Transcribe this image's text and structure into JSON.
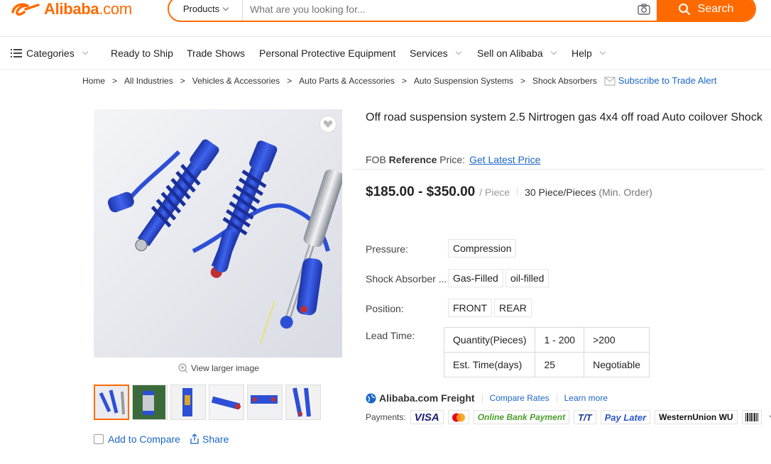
{
  "header": {
    "logo_brand": "Alibaba",
    "logo_suffix": ".com",
    "search_category": "Products",
    "search_placeholder": "What are you looking for...",
    "search_button": "Search"
  },
  "nav": {
    "categories": "Categories",
    "items": [
      "Ready to Ship",
      "Trade Shows",
      "Personal Protective Equipment",
      "Services",
      "Sell on Alibaba",
      "Help"
    ]
  },
  "breadcrumb": {
    "items": [
      "Home",
      "All Industries",
      "Vehicles & Accessories",
      "Auto Parts & Accessories",
      "Auto Suspension Systems",
      "Shock Absorbers"
    ],
    "separator": ">",
    "subscribe": "Subscribe to Trade Alert"
  },
  "gallery": {
    "view_larger": "View larger image",
    "add_to_compare": "Add to Compare",
    "share": "Share"
  },
  "product": {
    "title": "Off road suspension system 2.5 Nirtrogen gas 4x4 off road Auto coilover Shock",
    "fob_prefix": "FOB",
    "fob_bold": "Reference",
    "fob_suffix": "Price:",
    "fob_link": "Get Latest Price",
    "price": "$185.00 - $350.00",
    "unit": "/ Piece",
    "moq": "30 Piece/Pieces",
    "moq_note": "(Min. Order)",
    "attributes": {
      "pressure_label": "Pressure:",
      "pressure_values": [
        "Compression"
      ],
      "type_label": "Shock Absorber ...",
      "type_values": [
        "Gas-Filled",
        "oil-filled"
      ],
      "position_label": "Position:",
      "position_values": [
        "FRONT",
        "REAR"
      ]
    },
    "lead_time": {
      "label": "Lead Time:",
      "rows": [
        [
          "Quantity(Pieces)",
          "1 - 200",
          ">200"
        ],
        [
          "Est. Time(days)",
          "25",
          "Negotiable"
        ]
      ]
    },
    "freight": {
      "brand": "Alibaba.com Freight",
      "compare": "Compare Rates",
      "learn": "Learn more"
    },
    "payments": {
      "label": "Payments:",
      "methods": [
        "VISA",
        "Online Bank Payment",
        "T/T",
        "Pay Later",
        "WesternUnion WU"
      ]
    }
  },
  "colors": {
    "brand": "#ff6a00",
    "link": "#1a66c7",
    "shock_blue": "#2d4fd6"
  }
}
